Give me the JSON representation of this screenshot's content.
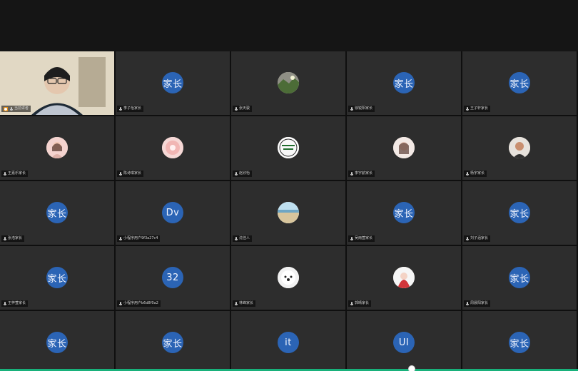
{
  "tiles": [
    {
      "label": "当前讲者",
      "avatar": null,
      "avatar_type": "video",
      "speaker": true
    },
    {
      "label": "李子怡家长",
      "avatar": "家长",
      "avatar_type": "text"
    },
    {
      "label": "张天骏",
      "avatar": null,
      "avatar_type": "photo",
      "photo_style": "landscape"
    },
    {
      "label": "徐锐阳家长",
      "avatar": "家长",
      "avatar_type": "text"
    },
    {
      "label": "王子轩家长",
      "avatar": "家长",
      "avatar_type": "text"
    },
    {
      "label": "王嘉乐家长",
      "avatar": null,
      "avatar_type": "photo",
      "photo_style": "girl"
    },
    {
      "label": "陈诗琪家长",
      "avatar": null,
      "avatar_type": "photo",
      "photo_style": "flower"
    },
    {
      "label": "赵欣怡",
      "avatar": null,
      "avatar_type": "photo",
      "photo_style": "badge"
    },
    {
      "label": "李宇航家长",
      "avatar": null,
      "avatar_type": "photo",
      "photo_style": "lady"
    },
    {
      "label": "杨宇家长",
      "avatar": null,
      "avatar_type": "photo",
      "photo_style": "man"
    },
    {
      "label": "张浩家长",
      "avatar": "家长",
      "avatar_type": "text"
    },
    {
      "label": "小程序用户9f3a27c4",
      "avatar": "Dv",
      "avatar_type": "text"
    },
    {
      "label": "沈佳人",
      "avatar": null,
      "avatar_type": "photo",
      "photo_style": "sea"
    },
    {
      "label": "吴雨萱家长",
      "avatar": "家长",
      "avatar_type": "text"
    },
    {
      "label": "刘子涵家长",
      "avatar": "家长",
      "avatar_type": "text"
    },
    {
      "label": "王梓萱家长",
      "avatar": "家长",
      "avatar_type": "text"
    },
    {
      "label": "小程序用户b6d8f0a2",
      "avatar": "32",
      "avatar_type": "text"
    },
    {
      "label": "林峰家长",
      "avatar": null,
      "avatar_type": "photo",
      "photo_style": "dog"
    },
    {
      "label": "郭晴家长",
      "avatar": null,
      "avatar_type": "photo",
      "photo_style": "red"
    },
    {
      "label": "周晨阳家长",
      "avatar": "家长",
      "avatar_type": "text"
    },
    {
      "label": "",
      "avatar": "家长",
      "avatar_type": "text"
    },
    {
      "label": "",
      "avatar": "家长",
      "avatar_type": "text"
    },
    {
      "label": "",
      "avatar": "it",
      "avatar_type": "text"
    },
    {
      "label": "",
      "avatar": "UI",
      "avatar_type": "text"
    },
    {
      "label": "",
      "avatar": "家长",
      "avatar_type": "text"
    }
  ],
  "colors": {
    "avatar_blue": "#2b64b5",
    "tile_bg": "#2d2d2d",
    "grid_bg": "#0f0f0f",
    "accent_green": "#18b17b"
  }
}
